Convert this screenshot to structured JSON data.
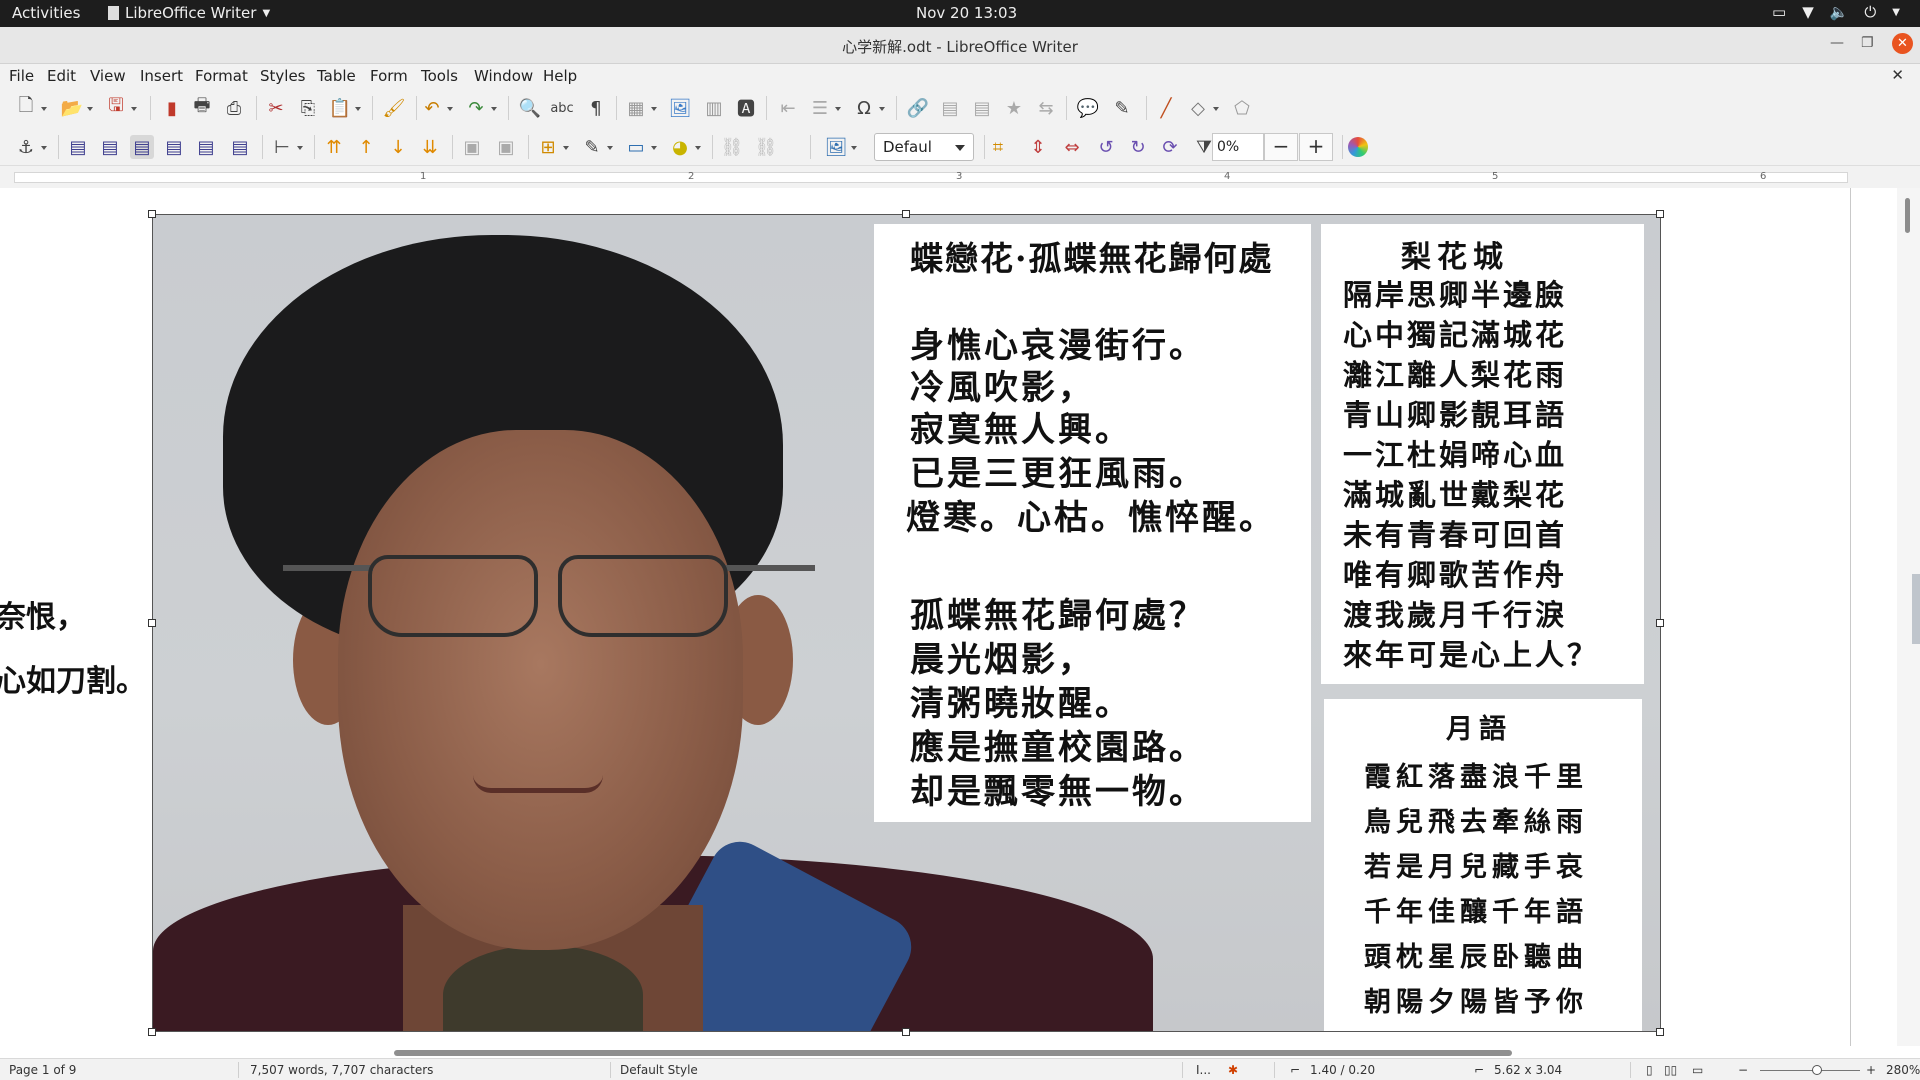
{
  "topbar": {
    "activities": "Activities",
    "app_name": "LibreOffice Writer",
    "clock": "Nov 20  13:03"
  },
  "window": {
    "title": "心学新解.odt - LibreOffice Writer"
  },
  "menu": [
    "File",
    "Edit",
    "View",
    "Insert",
    "Format",
    "Styles",
    "Table",
    "Form",
    "Tools",
    "Window",
    "Help"
  ],
  "toolbar2": {
    "frame_style": "Defaul",
    "transparency": "0%"
  },
  "ruler": {
    "numbers": [
      "1",
      "2",
      "3",
      "4",
      "5",
      "6"
    ]
  },
  "document": {
    "body_lines": [
      "奈恨，",
      "心如刀割。"
    ]
  },
  "poems": {
    "p1": {
      "title": "蝶戀花·孤蝶無花歸何處",
      "stanza1": [
        "身憔心哀漫街行。",
        "冷風吹影，",
        "寂寞無人興。",
        "已是三更狂風雨。",
        "燈寒。心枯。憔悴醒。"
      ],
      "stanza2": [
        "孤蝶無花歸何處？",
        "晨光烟影，",
        "清粥曉妝醒。",
        "應是撫童校園路。",
        "却是飄零無一物。"
      ]
    },
    "p2": {
      "title": "梨花城",
      "lines": [
        "隔岸思卿半邊臉",
        "心中獨記滿城花",
        "灕江離人梨花雨",
        "青山卿影靚耳語",
        "一江杜娟啼心血",
        "滿城亂世戴梨花",
        "未有青春可回首",
        "唯有卿歌苦作舟",
        "渡我歲月千行淚",
        "來年可是心上人？"
      ]
    },
    "p3": {
      "title": "月語",
      "lines": [
        "霞紅落盡浪千里",
        "鳥兒飛去牽絲雨",
        "若是月兒藏手哀",
        "千年佳釀千年語",
        "頭枕星辰卧聽曲",
        "朝陽夕陽皆予你"
      ]
    }
  },
  "status": {
    "page": "Page 1 of 9",
    "words": "7,507 words, 7,707 characters",
    "page_style": "Default Style",
    "position": "1.40 / 0.20",
    "size": "5.62 x 3.04",
    "zoom": "280%"
  },
  "colors": {
    "topbar_bg": "#1d1d1d",
    "close_button": "#e95420",
    "chrome_bg": "#f2f2f2",
    "page_bg": "#ffffff"
  }
}
